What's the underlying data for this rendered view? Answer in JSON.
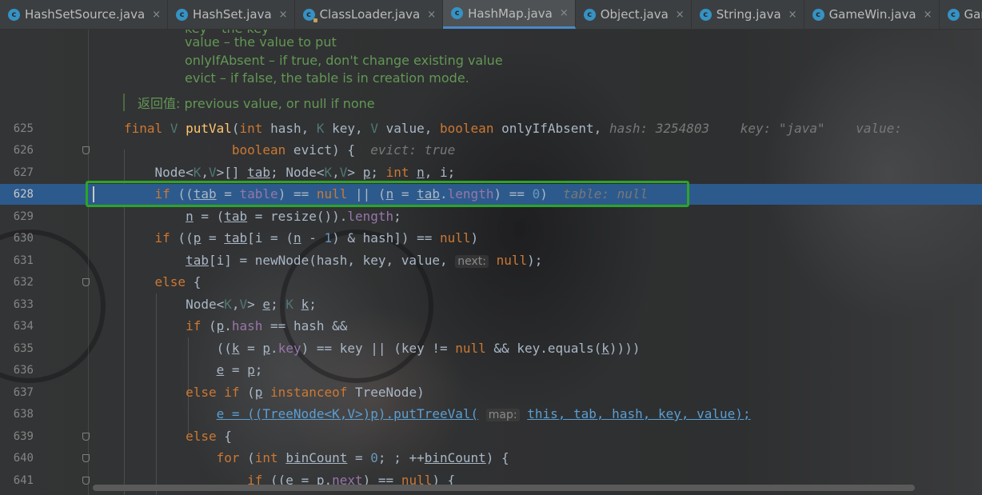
{
  "tabs": [
    {
      "name": "HashSetSource.java",
      "active": false
    },
    {
      "name": "HashSet.java",
      "active": false
    },
    {
      "name": "ClassLoader.java",
      "active": false
    },
    {
      "name": "HashMap.java",
      "active": true
    },
    {
      "name": "Object.java",
      "active": false
    },
    {
      "name": "String.java",
      "active": false
    },
    {
      "name": "GameWin.java",
      "active": false
    },
    {
      "name": "Game",
      "active": false
    }
  ],
  "tab_close_glyph": "×",
  "tab_icon_glyph": "c",
  "doc": {
    "key_line": "key – the key",
    "value_line": "value – the value to put",
    "only_if_absent_line": "onlyIfAbsent – if true, don't change existing value",
    "evict_line": "evict – if false, the table is in creation mode.",
    "returns_label": "返回值:",
    "returns_text": " previous value, or null if none"
  },
  "line_numbers": {
    "l625": "625",
    "l626": "626",
    "l627": "627",
    "l628": "628",
    "l629": "629",
    "l630": "630",
    "l631": "631",
    "l632": "632",
    "l633": "633",
    "l634": "634",
    "l635": "635",
    "l636": "636",
    "l637": "637",
    "l638": "638",
    "l639": "639",
    "l640": "640",
    "l641": "641"
  },
  "hints": {
    "l625_hash": "hash: 3254803",
    "l625_key": "key: \"java\"",
    "l625_value": "value:",
    "l626_evict": "evict: true",
    "l628_table": "table: null",
    "l631_next": "next:",
    "l638_map": "map:"
  },
  "colors": {
    "editor_bg": "#2b2b2b",
    "keyword": "#cc7832",
    "method": "#ffc66d",
    "number": "#6897bb",
    "field": "#9876aa",
    "comment_doc": "#629755",
    "current_line": "#2d5a8c",
    "highlight_box": "#2ca42a",
    "tab_active_underline": "#4a88c7"
  }
}
